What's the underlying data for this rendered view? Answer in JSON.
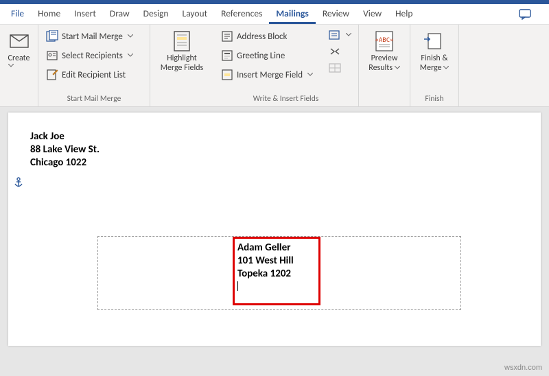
{
  "tabs": {
    "file": "File",
    "home": "Home",
    "insert": "Insert",
    "draw": "Draw",
    "design": "Design",
    "layout": "Layout",
    "references": "References",
    "mailings": "Mailings",
    "review": "Review",
    "view": "View",
    "help": "Help"
  },
  "ribbon": {
    "create": {
      "label": "Create"
    },
    "startMailMerge": {
      "startMerge": "Start Mail Merge",
      "selectRecipients": "Select Recipients",
      "editRecipient": "Edit Recipient List",
      "groupLabel": "Start Mail Merge"
    },
    "highlight": {
      "label1": "Highlight",
      "label2": "Merge Fields"
    },
    "writeInsert": {
      "addressBlock": "Address Block",
      "greetingLine": "Greeting Line",
      "insertMergeField": "Insert Merge Field",
      "groupLabel": "Write & Insert Fields"
    },
    "preview": {
      "label1": "Preview",
      "label2": "Results",
      "groupLabel": ""
    },
    "finish": {
      "label1": "Finish &",
      "label2": "Merge",
      "groupLabel": "Finish"
    }
  },
  "document": {
    "returnAddress": {
      "name": "Jack Joe",
      "street": "88 Lake View St.",
      "city": "Chicago 1022"
    },
    "deliveryAddress": {
      "name": "Adam Geller",
      "street": "101 West Hill",
      "city": "Topeka 1202"
    }
  },
  "watermark": "wsxdn.com"
}
